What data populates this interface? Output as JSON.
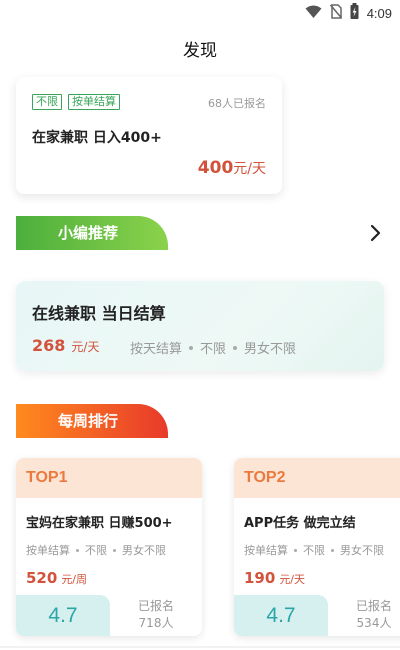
{
  "status_bar": {
    "time": "4:09",
    "icons": [
      "wifi-icon",
      "no-sim-icon",
      "battery-icon"
    ]
  },
  "page": {
    "title": "发现"
  },
  "top_job": {
    "tags": [
      "不限",
      "按单结算"
    ],
    "signup_count": "68人已报名",
    "title": "在家兼职 日入400+",
    "price": "400",
    "unit": "元/天"
  },
  "recommend_section": {
    "label": "小编推荐",
    "arrow_icon": "chevron-right-icon",
    "card": {
      "title": "在线兼职 当日结算",
      "price": "268",
      "unit": "元/天",
      "meta": [
        "按天结算",
        "不限",
        "男女不限"
      ]
    }
  },
  "weekly_section": {
    "label": "每周排行",
    "items": [
      {
        "rank": "TOP1",
        "title": "宝妈在家兼职 日赚500+",
        "meta": [
          "按单结算",
          "不限",
          "男女不限"
        ],
        "price": "520",
        "unit": "元/周",
        "score": "4.7",
        "signed_label": "已报名",
        "signed_count": "718人"
      },
      {
        "rank": "TOP2",
        "title": "APP任务 做完立结",
        "meta": [
          "按单结算",
          "不限",
          "男女不限"
        ],
        "price": "190",
        "unit": "元/天",
        "score": "4.7",
        "signed_label": "已报名",
        "signed_count": "534人"
      }
    ]
  },
  "colors": {
    "accent_green": "#4caf3c",
    "accent_orange": "#ff8a1e",
    "price_red": "#d2523b",
    "rank_orange": "#ea7a3e",
    "score_teal": "#2ba6a6"
  }
}
